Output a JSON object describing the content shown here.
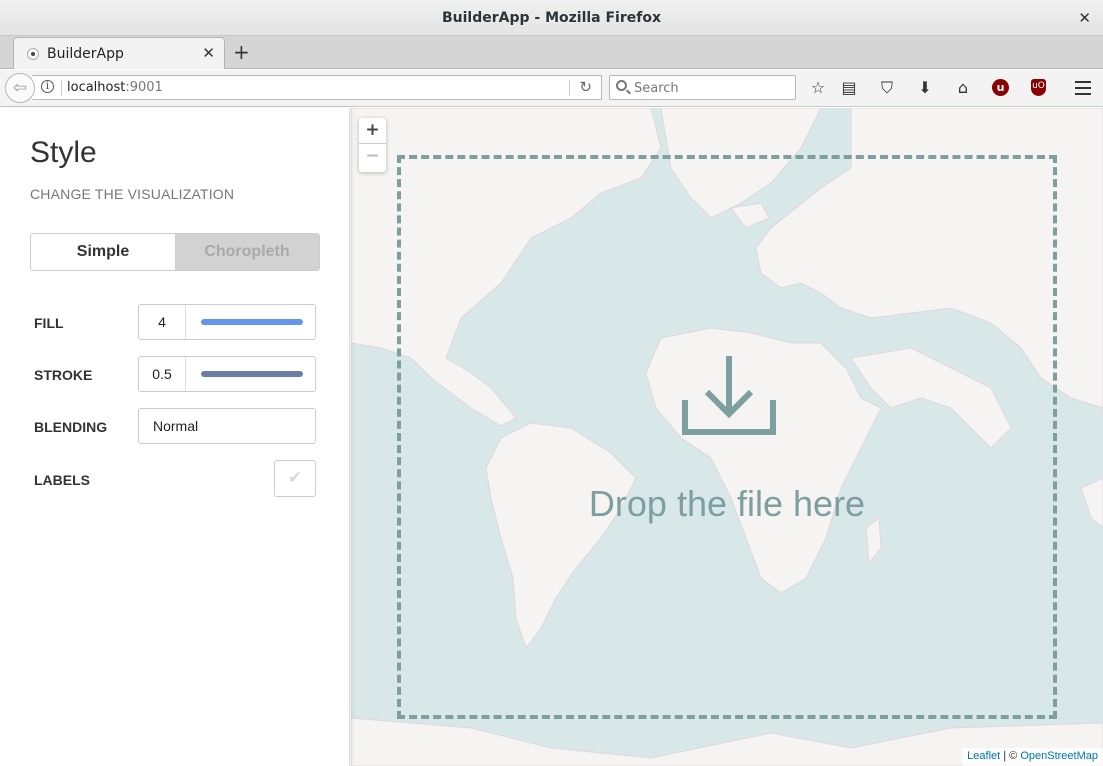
{
  "window": {
    "title": "BuilderApp - Mozilla Firefox",
    "close_glyph": "✕"
  },
  "tabs": [
    {
      "label": "BuilderApp",
      "close_glyph": "✕"
    }
  ],
  "new_tab_glyph": "+",
  "navbar": {
    "back_glyph": "⇦",
    "url_host": "localhost",
    "url_port": ":9001",
    "reload_glyph": "↻",
    "search_placeholder": "Search",
    "icons": [
      "bookmark-star-icon",
      "reading-list-icon",
      "pocket-icon",
      "download-icon",
      "home-icon",
      "ublock-icon",
      "umatrix-icon",
      "menu-icon"
    ],
    "bookmark_glyph": "☆",
    "reader_glyph": "▤",
    "pocket_glyph": "⛉",
    "download_glyph": "⬇",
    "home_glyph": "⌂",
    "ublock_glyph": "u",
    "umatrix_glyph": "uO"
  },
  "panel": {
    "heading": "Style",
    "subheading": "CHANGE THE VISUALIZATION",
    "toggle": {
      "options": [
        "Simple",
        "Choropleth"
      ],
      "selected": "Simple"
    },
    "rows": {
      "fill": {
        "label": "FILL",
        "value": "4",
        "color": "#6495ed"
      },
      "stroke": {
        "label": "STROKE",
        "value": "0.5",
        "color": "#6a7fa6"
      },
      "blending": {
        "label": "BLENDING",
        "value": "Normal"
      },
      "labels": {
        "label": "LABELS",
        "checked": false,
        "check_glyph": "✔"
      }
    }
  },
  "map": {
    "zoom_in": "+",
    "zoom_out": "−",
    "drop_text": "Drop the file here",
    "attribution": {
      "leaflet": "Leaflet",
      "sep": " | © ",
      "osm": "OpenStreetMap"
    },
    "colors": {
      "water": "#d8e7e7",
      "land": "#f5f4f2",
      "accent": "#7d9f9f"
    }
  }
}
